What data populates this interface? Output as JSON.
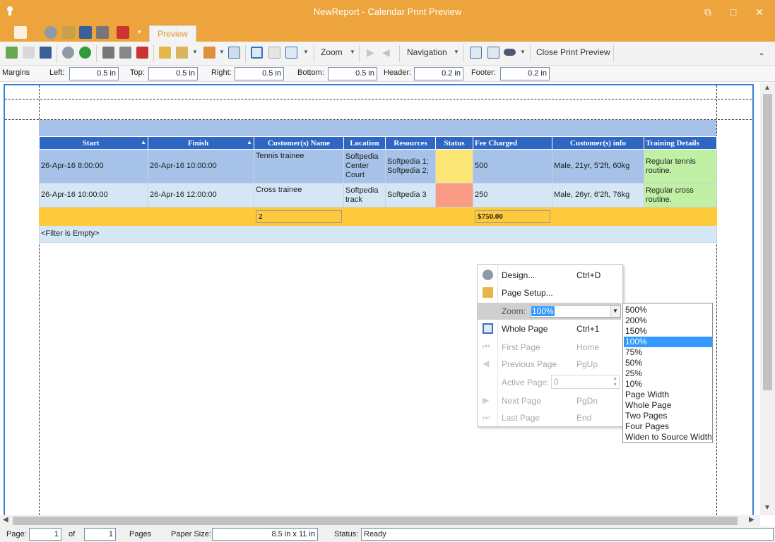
{
  "window": {
    "title": "NewReport - Calendar Print Preview",
    "restore": "⧉",
    "maximize": "□",
    "close": "✕"
  },
  "ribbon": {
    "tab": "Preview"
  },
  "toolbar": {
    "zoom_label": "Zoom",
    "navigation_label": "Navigation",
    "close_label": "Close Print Preview",
    "collapse": "⌃"
  },
  "margins": {
    "title": "Margins",
    "left_label": "Left:",
    "left": "0.5 in",
    "top_label": "Top:",
    "top": "0.5 in",
    "right_label": "Right:",
    "right": "0.5 in",
    "bottom_label": "Bottom:",
    "bottom": "0.5 in",
    "header_label": "Header:",
    "header": "0.2 in",
    "footer_label": "Footer:",
    "footer": "0.2 in"
  },
  "report": {
    "columns": [
      "Start",
      "Finish",
      "Customer(s) Name",
      "Location",
      "Resources",
      "Status",
      "Fee Charged",
      "Customer(s) info",
      "Training Details"
    ],
    "rows": [
      {
        "start": "26-Apr-16 8:00:00",
        "finish": "26-Apr-16 10:00:00",
        "name": "Tennis trainee",
        "location": "Softpedia Center Court",
        "resources": "Softpedia 1; Softpedia 2;",
        "fee": "500",
        "info": "Male, 21yr, 5'2ft, 60kg",
        "details": "Regular tennis routine.",
        "status_color": "#fbe575"
      },
      {
        "start": "26-Apr-16 10:00:00",
        "finish": "26-Apr-16 12:00:00",
        "name": "Cross trainee",
        "location": "Softpedia track",
        "resources": "Softpedia 3",
        "fee": "250",
        "info": "Male, 26yr, 6'2ft, 76kg",
        "details": "Regular cross routine.",
        "status_color": "#f89a84"
      }
    ],
    "summary_count": "2",
    "summary_fee": "$750.00",
    "filter": "<Filter is Empty>"
  },
  "context_menu": {
    "design": "Design...",
    "design_shortcut": "Ctrl+D",
    "page_setup": "Page Setup...",
    "zoom_label": "Zoom:",
    "zoom_value": "100%",
    "whole_page": "Whole Page",
    "whole_page_shortcut": "Ctrl+1",
    "first_page": "First Page",
    "first_page_shortcut": "Home",
    "previous_page": "Previous Page",
    "previous_page_shortcut": "PgUp",
    "active_page": "Active Page:",
    "active_page_value": "0",
    "next_page": "Next Page",
    "next_page_shortcut": "PgDn",
    "last_page": "Last Page",
    "last_page_shortcut": "End"
  },
  "zoom_options": [
    "500%",
    "200%",
    "150%",
    "100%",
    "75%",
    "50%",
    "25%",
    "10%",
    "Page Width",
    "Whole Page",
    "Two Pages",
    "Four Pages",
    "Widen to Source Width"
  ],
  "zoom_selected": "100%",
  "status": {
    "page_label": "Page:",
    "page": "1",
    "of_label": "of",
    "total": "1",
    "pages_label": "Pages",
    "paper_label": "Paper Size:",
    "paper": "8.5 in x 11 in",
    "status_label": "Status:",
    "status": "Ready"
  },
  "colors": {
    "title_bar": "#eda43c",
    "header_blue": "#2e66c3",
    "row1": "#a6c2e8",
    "row2": "#d5e6f4",
    "summary": "#fec93b",
    "details": "#bff0a4"
  }
}
